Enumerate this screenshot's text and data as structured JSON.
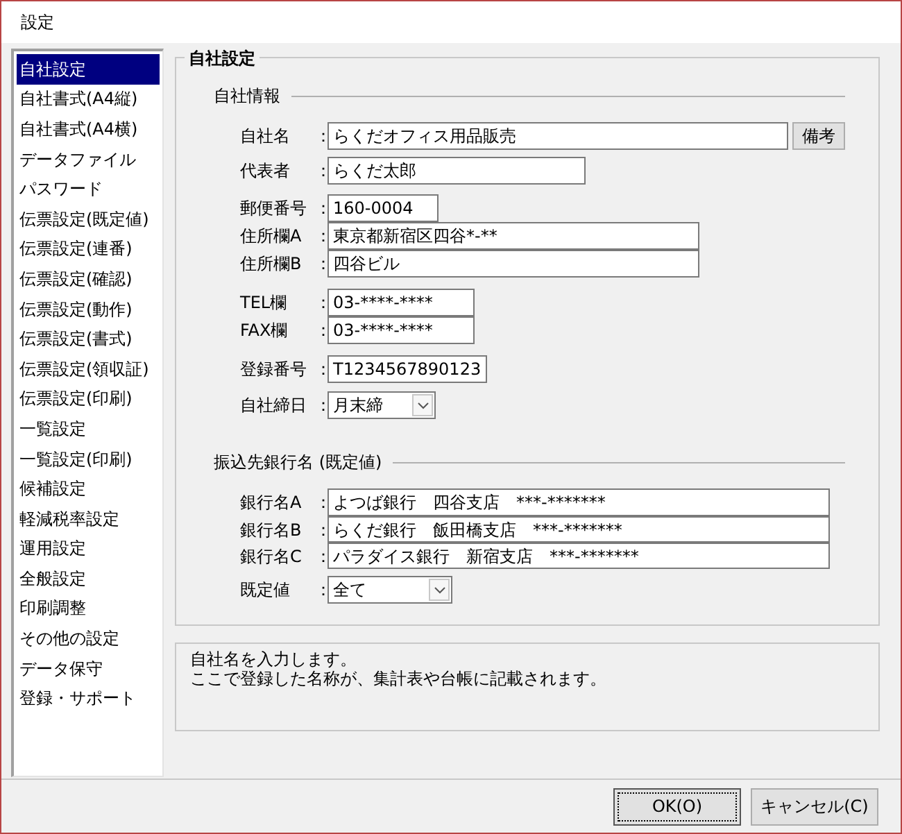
{
  "window": {
    "title": "設定"
  },
  "sidebar": {
    "items": [
      {
        "label": "自社設定",
        "selected": true
      },
      {
        "label": "自社書式(A4縦)",
        "selected": false
      },
      {
        "label": "自社書式(A4横)",
        "selected": false
      },
      {
        "label": "データファイル",
        "selected": false
      },
      {
        "label": "パスワード",
        "selected": false
      },
      {
        "label": "伝票設定(既定値)",
        "selected": false
      },
      {
        "label": "伝票設定(連番)",
        "selected": false
      },
      {
        "label": "伝票設定(確認)",
        "selected": false
      },
      {
        "label": "伝票設定(動作)",
        "selected": false
      },
      {
        "label": "伝票設定(書式)",
        "selected": false
      },
      {
        "label": "伝票設定(領収証)",
        "selected": false
      },
      {
        "label": "伝票設定(印刷)",
        "selected": false
      },
      {
        "label": "一覧設定",
        "selected": false
      },
      {
        "label": "一覧設定(印刷)",
        "selected": false
      },
      {
        "label": "候補設定",
        "selected": false
      },
      {
        "label": "軽減税率設定",
        "selected": false
      },
      {
        "label": "運用設定",
        "selected": false
      },
      {
        "label": "全般設定",
        "selected": false
      },
      {
        "label": "印刷調整",
        "selected": false
      },
      {
        "label": "その他の設定",
        "selected": false
      },
      {
        "label": "データ保守",
        "selected": false
      },
      {
        "label": "登録・サポート",
        "selected": false
      }
    ]
  },
  "panel": {
    "title": "自社設定",
    "sections": [
      {
        "title": "自社情報",
        "fields": [
          {
            "kind": "text_button",
            "label": "自社名",
            "colon": "：",
            "value": "らくだオフィス用品販売",
            "button": "備考"
          },
          {
            "kind": "text",
            "label": "代表者",
            "colon": "：",
            "value": "らくだ太郎"
          },
          {
            "kind": "text",
            "label": "郵便番号",
            "colon": "：",
            "value": "160-0004"
          },
          {
            "kind": "text",
            "label": "住所欄A",
            "colon": "：",
            "value": "東京都新宿区四谷*-**"
          },
          {
            "kind": "text",
            "label": "住所欄B",
            "colon": "：",
            "value": "四谷ビル"
          },
          {
            "kind": "text",
            "label": "TEL欄",
            "colon": "：",
            "value": "03-****-****"
          },
          {
            "kind": "text",
            "label": "FAX欄",
            "colon": "：",
            "value": "03-****-****"
          },
          {
            "kind": "text",
            "label": "登録番号",
            "colon": "：",
            "value": "T1234567890123"
          },
          {
            "kind": "combo",
            "label": "自社締日",
            "colon": "：",
            "value": "月末締"
          }
        ]
      },
      {
        "title": "振込先銀行名 (既定値)",
        "fields": [
          {
            "kind": "text",
            "label": "銀行名A",
            "colon": "：",
            "value": "よつば銀行　四谷支店　***-*******"
          },
          {
            "kind": "text",
            "label": "銀行名B",
            "colon": "：",
            "value": "らくだ銀行　飯田橋支店　***-*******"
          },
          {
            "kind": "text",
            "label": "銀行名C",
            "colon": "：",
            "value": "パラダイス銀行　新宿支店　***-*******"
          },
          {
            "kind": "combo",
            "label": "既定値",
            "colon": "：",
            "value": "全て"
          }
        ]
      }
    ]
  },
  "help": {
    "lines": [
      "自社名を入力します。",
      "ここで登録した名称が、集計表や台帳に記載されます。"
    ]
  },
  "buttons": [
    {
      "label": "OK(O)",
      "focused": true
    },
    {
      "label": "キャンセル(C)",
      "focused": false
    }
  ]
}
